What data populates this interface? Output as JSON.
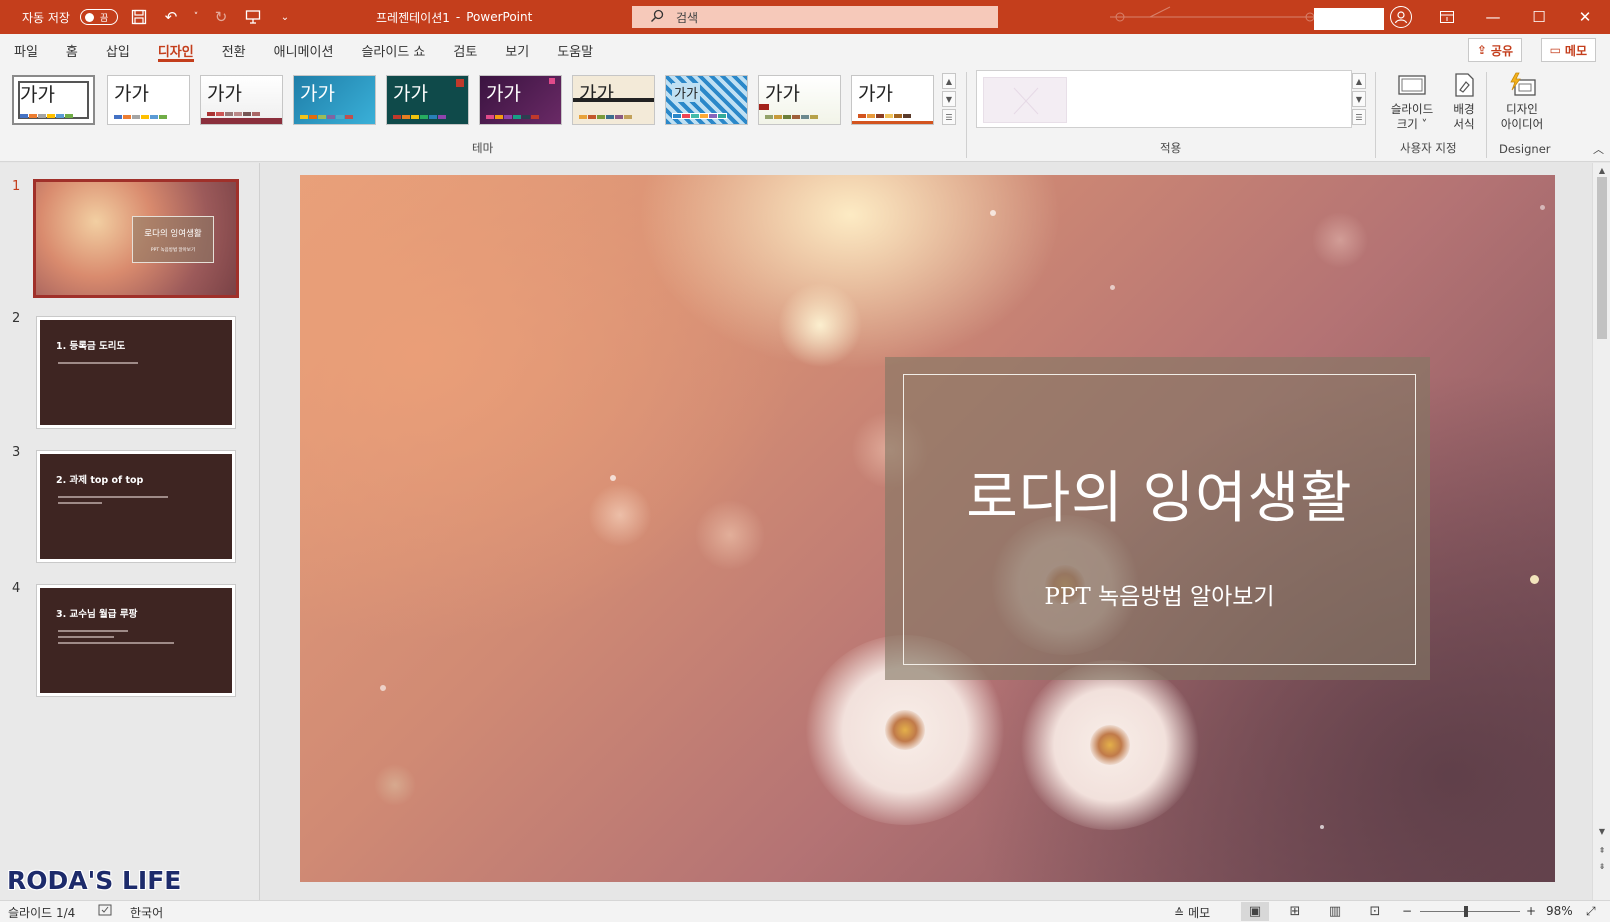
{
  "titlebar": {
    "autosave_label": "자동 저장",
    "autosave_state": "끔",
    "doc_title": "프레젠테이션1",
    "separator": "-",
    "app_name": "PowerPoint",
    "search_placeholder": "검색"
  },
  "tabs": [
    {
      "label": "파일"
    },
    {
      "label": "홈"
    },
    {
      "label": "삽입"
    },
    {
      "label": "디자인"
    },
    {
      "label": "전환"
    },
    {
      "label": "애니메이션"
    },
    {
      "label": "슬라이드 쇼"
    },
    {
      "label": "검토"
    },
    {
      "label": "보기"
    },
    {
      "label": "도움말"
    }
  ],
  "share_label": "공유",
  "memo_label": "메모",
  "ribbon": {
    "theme_text": "가가",
    "themes_group": "테마",
    "variants_group": "적용",
    "slide_size": "슬라이드\n크기 ˅",
    "slide_size_l1": "슬라이드",
    "slide_size_l2": "크기 ˅",
    "format_bg_l1": "배경",
    "format_bg_l2": "서식",
    "customize_group": "사용자 지정",
    "design_ideas_l1": "디자인",
    "design_ideas_l2": "아이디어",
    "designer_group": "Designer"
  },
  "slides": [
    {
      "num": "1",
      "title": "로다의 잉여생활",
      "subtitle": "PPT 녹음방법 알아보기"
    },
    {
      "num": "2",
      "title": "1. 등록금 도리도"
    },
    {
      "num": "3",
      "title": "2. 과제 top of top"
    },
    {
      "num": "4",
      "title": "3. 교수님 월급 루팡"
    }
  ],
  "main_slide": {
    "title": "로다의 잉여생활",
    "subtitle": "PPT 녹음방법 알아보기"
  },
  "watermark": "RODA'S LIFE",
  "statusbar": {
    "slide_counter": "슬라이드 1/4",
    "language": "한국어",
    "notes_label": "메모",
    "zoom": "98%"
  },
  "colors": {
    "accent": "#c43e1c",
    "search_bg": "#f6c9ba",
    "thumb_bg": "#3e2522"
  }
}
